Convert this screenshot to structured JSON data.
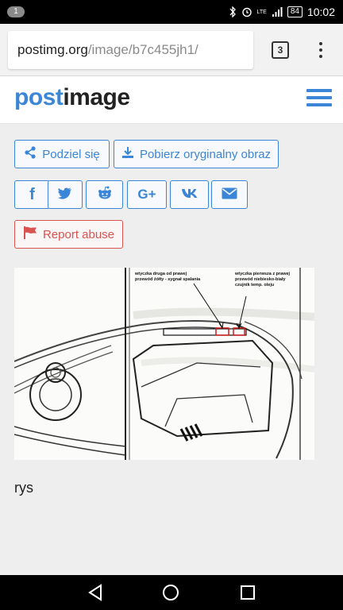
{
  "status_bar": {
    "notification_count": "1",
    "battery": "84",
    "time": "10:02",
    "icons": [
      "bluetooth-icon",
      "alarm-icon",
      "lte-icon",
      "signal-icon",
      "battery-icon"
    ]
  },
  "browser": {
    "url_host": "postimg.org",
    "url_path": "/image/b7c455jh1/",
    "tab_count": "3"
  },
  "site": {
    "logo_part1": "post",
    "logo_part2": "image",
    "accent_color": "#3b86d6",
    "danger_color": "#d9534f"
  },
  "actions": {
    "share_label": "Podziel się",
    "download_label": "Pobierz oryginalny obraz",
    "report_label": "Report abuse",
    "social": [
      "facebook-icon",
      "twitter-icon",
      "reddit-icon",
      "google-plus-icon",
      "vk-icon",
      "mail-icon"
    ],
    "google_plus_label": "G+"
  },
  "figure": {
    "annotation_left_line1": "wtyczka druga od prawej",
    "annotation_left_line2": "przewód żółty - sygnał spalania",
    "annotation_right_line1": "wtyczka pierwsza z prawej",
    "annotation_right_line2": "przewód niebiesko-biały",
    "annotation_right_line3": "czujnik temp. oleju"
  },
  "caption": "rys"
}
